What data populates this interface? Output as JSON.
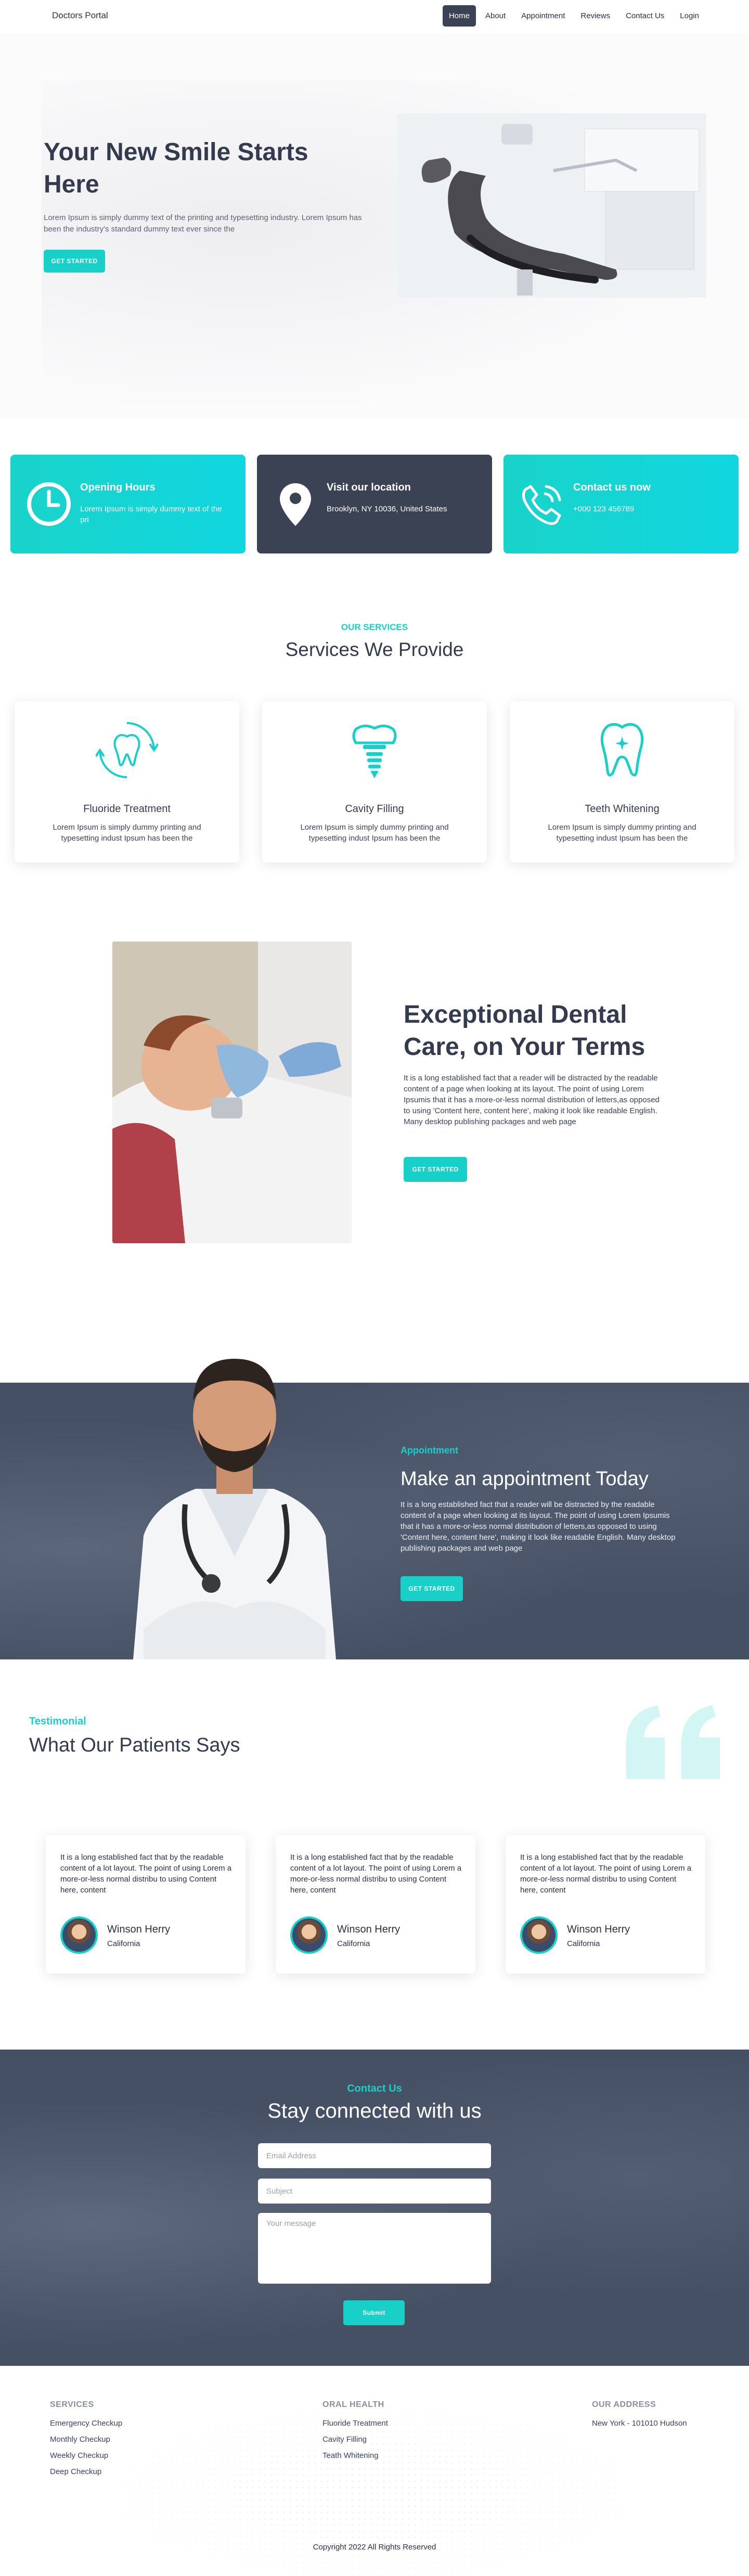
{
  "nav": {
    "brand": "Doctors Portal",
    "items": [
      {
        "label": "Home",
        "active": true
      },
      {
        "label": "About"
      },
      {
        "label": "Appointment"
      },
      {
        "label": "Reviews"
      },
      {
        "label": "Contact Us"
      },
      {
        "label": "Login"
      }
    ]
  },
  "hero": {
    "title": "Your New Smile Starts Here",
    "text": "Lorem Ipsum is simply dummy text of the printing and typesetting industry. Lorem Ipsum has been the industry's standard dummy text ever since the",
    "button": "GET STARTED"
  },
  "info": [
    {
      "title": "Opening Hours",
      "text": "Lorem Ipsum is simply dummy text of the pri",
      "icon": "clock-icon"
    },
    {
      "title": "Visit our location",
      "text": "Brooklyn, NY 10036, United States",
      "icon": "location-pin-icon"
    },
    {
      "title": "Contact us now",
      "text": "+000 123 456789",
      "icon": "phone-icon"
    }
  ],
  "services": {
    "sub": "OUR SERVICES",
    "title": "Services We Provide",
    "items": [
      {
        "title": "Fluoride Treatment",
        "text": "Lorem Ipsum is simply dummy printing and typesetting indust Ipsum has been the",
        "icon": "tooth-cycle-icon"
      },
      {
        "title": "Cavity Filling",
        "text": "Lorem Ipsum is simply dummy printing and typesetting indust Ipsum has been the",
        "icon": "dental-implant-icon"
      },
      {
        "title": "Teeth Whitening",
        "text": "Lorem Ipsum is simply dummy printing and typesetting indust Ipsum has been the",
        "icon": "tooth-sparkle-icon"
      }
    ]
  },
  "exceptional": {
    "title": "Exceptional Dental Care, on Your Terms",
    "text": "It is a long established fact that a reader will be distracted by the readable content of a page when looking at its layout. The point of using Lorem Ipsumis that it has a more-or-less normal distribution of letters,as opposed to using 'Content here, content here', making it look like readable English. Many desktop publishing packages and web page",
    "button": "GET STARTED"
  },
  "appointment": {
    "sub": "Appointment",
    "title": "Make an appointment Today",
    "text": "It is a long established fact that a reader will be distracted by the readable content of a page when looking at its layout. The point of using Lorem Ipsumis that it has a more-or-less normal distribution of letters,as opposed to using 'Content here, content here', making it look like readable English. Many desktop publishing packages and web page",
    "button": "GET STARTED"
  },
  "testimonial": {
    "sub": "Testimonial",
    "title": "What Our Patients Says",
    "items": [
      {
        "text": "It is a long established fact that by the readable content of a lot layout. The point of using Lorem a more-or-less normal distribu to using Content here, content",
        "name": "Winson Herry",
        "city": "California"
      },
      {
        "text": "It is a long established fact that by the readable content of a lot layout. The point of using Lorem a more-or-less normal distribu to using Content here, content",
        "name": "Winson Herry",
        "city": "California"
      },
      {
        "text": "It is a long established fact that by the readable content of a lot layout. The point of using Lorem a more-or-less normal distribu to using Content here, content",
        "name": "Winson Herry",
        "city": "California"
      }
    ]
  },
  "contact": {
    "sub": "Contact Us",
    "title": "Stay connected with us",
    "email_placeholder": "Email Address",
    "subject_placeholder": "Subject",
    "message_placeholder": "Your message",
    "submit": "Submit"
  },
  "footer": {
    "services": {
      "title": "SERVICES",
      "items": [
        "Emergency Checkup",
        "Monthly Checkup",
        "Weekly Checkup",
        "Deep Checkup"
      ]
    },
    "oral": {
      "title": "ORAL HEALTH",
      "items": [
        "Fluoride Treatment",
        "Cavity Filling",
        "Teath Whitening"
      ]
    },
    "address": {
      "title": "OUR ADDRESS",
      "items": [
        "New York - 101010 Hudson"
      ]
    },
    "copyright": "Copyright 2022 All Rights Reserved"
  },
  "colors": {
    "accent": "#18d0c8",
    "dark": "#3a4254",
    "text": "#343b4e"
  }
}
